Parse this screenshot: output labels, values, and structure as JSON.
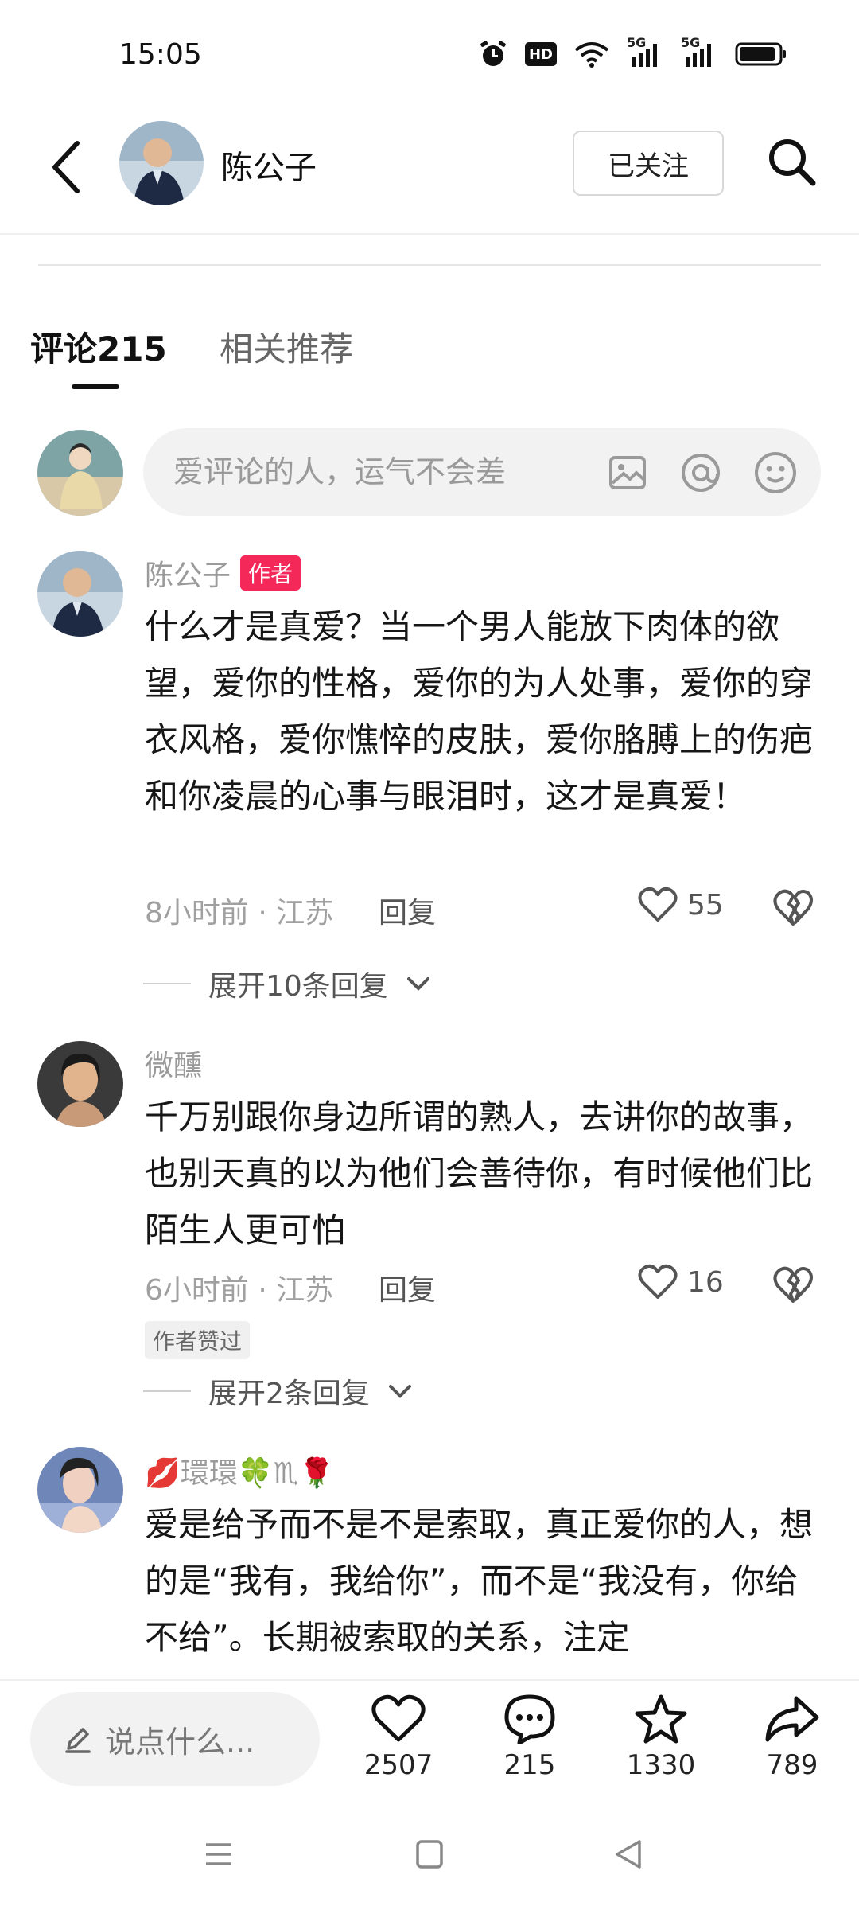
{
  "status_bar": {
    "time": "15:05",
    "icons": [
      "alarm-icon",
      "hd-icon",
      "wifi-icon",
      "signal-5g-icon",
      "signal-5g-icon",
      "battery-icon"
    ],
    "hd_label": "HD",
    "net1": "5G",
    "net2": "5G"
  },
  "header": {
    "author_name": "陈公子",
    "follow_label": "已关注",
    "icons": [
      "back-icon",
      "search-icon"
    ]
  },
  "tabs": [
    {
      "label": "评论215",
      "active": true
    },
    {
      "label": "相关推荐",
      "active": false
    }
  ],
  "comment_input": {
    "placeholder": "爱评论的人，运气不会差",
    "icons": [
      "image-icon",
      "at-icon",
      "emoji-icon"
    ]
  },
  "comments": [
    {
      "user": "陈公子",
      "badge": "作者",
      "text": "什么才是真爱？当一个男人能放下肉体的欲望，爱你的性格，爱你的为人处事，爱你的穿衣风格，爱你憔悴的皮肤，爱你胳膊上的伤疤和你凌晨的心事与眼泪时，这才是真爱！",
      "meta": "8小时前 · 江苏",
      "reply_label": "回复",
      "likes": "55",
      "expand": "展开10条回复"
    },
    {
      "user": "微醺",
      "text": "千万别跟你身边所谓的熟人，去讲你的故事，也别天真的以为他们会善待你，有时候他们比陌生人更可怕",
      "meta": "6小时前 · 江苏",
      "reply_label": "回复",
      "likes": "16",
      "liked_by_author": "作者赞过",
      "expand": "展开2条回复"
    },
    {
      "user": "💋環環🍀♏🌹",
      "text": "爱是给予而不是不是索取，真正爱你的人，想的是“我有，我给你”，而不是“我没有，你给不给”。长期被索取的关系，注定"
    }
  ],
  "bottom_bar": {
    "say_placeholder": "说点什么...",
    "likes": "2507",
    "comments": "215",
    "favorites": "1330",
    "shares": "789"
  },
  "colors": {
    "author_badge": "#f5285a",
    "input_bg": "#f2f2f2",
    "text": "#161616",
    "meta": "#a0a0a0"
  }
}
